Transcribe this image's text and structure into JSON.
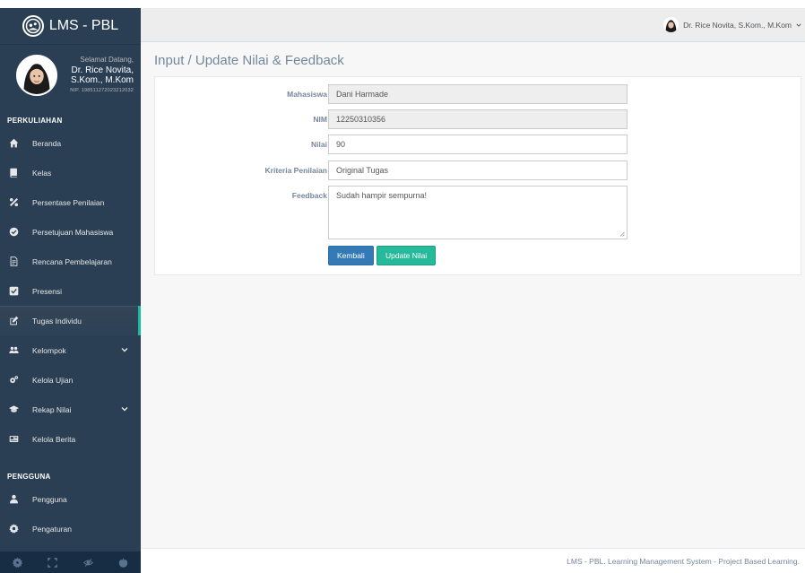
{
  "app": {
    "title": "LMS - PBL",
    "logo_text": "PBL"
  },
  "profile": {
    "welcome": "Selamat Datang,",
    "name_line1": "Dr. Rice Novita,",
    "name_line2": "S.Kom., M.Kom",
    "nip": "NIP. 198511272023212032"
  },
  "sidebar": {
    "sections": [
      {
        "title": "PERKULIAHAN",
        "items": [
          {
            "label": "Beranda",
            "icon": "home-icon"
          },
          {
            "label": "Kelas",
            "icon": "book-icon"
          },
          {
            "label": "Persentase Penilaian",
            "icon": "percent-icon"
          },
          {
            "label": "Persetujuan Mahasiswa",
            "icon": "check-circle-icon"
          },
          {
            "label": "Rencana Pembelajaran",
            "icon": "file-text-icon"
          },
          {
            "label": "Presensi",
            "icon": "checkbox-icon"
          },
          {
            "label": "Tugas Individu",
            "icon": "edit-icon",
            "active": true
          },
          {
            "label": "Kelompok",
            "icon": "users-icon",
            "has_submenu": true
          },
          {
            "label": "Kelola Ujian",
            "icon": "cogs-icon"
          },
          {
            "label": "Rekap Nilai",
            "icon": "graduation-cap-icon",
            "has_submenu": true
          },
          {
            "label": "Kelola Berita",
            "icon": "newspaper-icon"
          }
        ]
      },
      {
        "title": "PENGGUNA",
        "items": [
          {
            "label": "Pengguna",
            "icon": "user-icon"
          },
          {
            "label": "Pengaturan",
            "icon": "gear-icon"
          }
        ]
      }
    ],
    "footer_icons": [
      "settings-icon",
      "fullscreen-icon",
      "eye-slash-icon",
      "power-icon"
    ]
  },
  "header": {
    "user_name": "Dr. Rice Novita, S.Kom., M.Kom"
  },
  "page": {
    "title": "Input / Update Nilai & Feedback"
  },
  "form": {
    "mahasiswa": {
      "label": "Mahasiswa",
      "value": "Dani Harmade"
    },
    "nim": {
      "label": "NIM",
      "value": "12250310356"
    },
    "nilai": {
      "label": "Nilai",
      "value": "90"
    },
    "kriteria": {
      "label": "Kriteria Penilaian",
      "value": "Original Tugas"
    },
    "feedback": {
      "label": "Feedback",
      "value": "Sudah hampir sempurna!"
    },
    "back_label": "Kembali",
    "submit_label": "Update Nilai"
  },
  "footer": {
    "text": "LMS - PBL. Learning Management System - Project Based Learning."
  },
  "colors": {
    "sidebar_bg": "#2A3F54",
    "accent": "#1ABB9C",
    "primary_button": "#337AB7",
    "success_button": "#26B99A"
  }
}
